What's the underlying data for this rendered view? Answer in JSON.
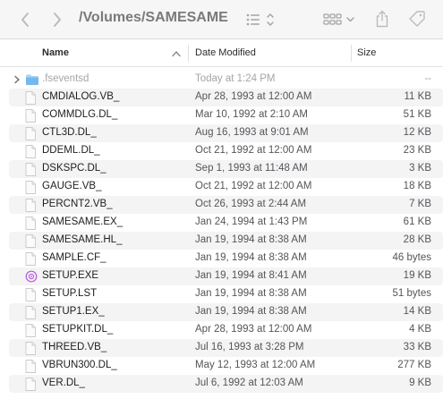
{
  "toolbar": {
    "title": "/Volumes/SAMESAME",
    "icons": [
      "chevron-left-icon",
      "chevron-right-icon",
      "list-view-icon",
      "grid-view-icon",
      "share-icon",
      "tag-icon"
    ]
  },
  "columns": {
    "name": "Name",
    "date": "Date Modified",
    "size": "Size",
    "sort_column": "Name",
    "sort_direction": "ascending"
  },
  "colors": {
    "folder": "#62b0ea",
    "setup_icon": "#b55ad6",
    "row_stripe": "#f4f4f5"
  },
  "files": [
    {
      "name": ".fseventsd",
      "date": "Today at 1:24 PM",
      "size": "--",
      "kind": "folder",
      "hidden": true
    },
    {
      "name": "CMDIALOG.VB_",
      "date": "Apr 28, 1993 at 12:00 AM",
      "size": "11 KB",
      "kind": "document"
    },
    {
      "name": "COMMDLG.DL_",
      "date": "Mar 10, 1992 at 2:10 AM",
      "size": "51 KB",
      "kind": "document"
    },
    {
      "name": "CTL3D.DL_",
      "date": "Aug 16, 1993 at 9:01 AM",
      "size": "12 KB",
      "kind": "document"
    },
    {
      "name": "DDEML.DL_",
      "date": "Oct 21, 1992 at 12:00 AM",
      "size": "23 KB",
      "kind": "document"
    },
    {
      "name": "DSKSPC.DL_",
      "date": "Sep 1, 1993 at 11:48 AM",
      "size": "3 KB",
      "kind": "document"
    },
    {
      "name": "GAUGE.VB_",
      "date": "Oct 21, 1992 at 12:00 AM",
      "size": "18 KB",
      "kind": "document"
    },
    {
      "name": "PERCNT2.VB_",
      "date": "Oct 26, 1993 at 2:44 AM",
      "size": "7 KB",
      "kind": "document"
    },
    {
      "name": "SAMESAME.EX_",
      "date": "Jan 24, 1994 at 1:43 PM",
      "size": "61 KB",
      "kind": "document"
    },
    {
      "name": "SAMESAME.HL_",
      "date": "Jan 19, 1994 at 8:38 AM",
      "size": "28 KB",
      "kind": "document"
    },
    {
      "name": "SAMPLE.CF_",
      "date": "Jan 19, 1994 at 8:38 AM",
      "size": "46 bytes",
      "kind": "document"
    },
    {
      "name": "SETUP.EXE",
      "date": "Jan 19, 1994 at 8:41 AM",
      "size": "19 KB",
      "kind": "executable"
    },
    {
      "name": "SETUP.LST",
      "date": "Jan 19, 1994 at 8:38 AM",
      "size": "51 bytes",
      "kind": "document"
    },
    {
      "name": "SETUP1.EX_",
      "date": "Jan 19, 1994 at 8:38 AM",
      "size": "14 KB",
      "kind": "document"
    },
    {
      "name": "SETUPKIT.DL_",
      "date": "Apr 28, 1993 at 12:00 AM",
      "size": "4 KB",
      "kind": "document"
    },
    {
      "name": "THREED.VB_",
      "date": "Jul 16, 1993 at 3:28 PM",
      "size": "33 KB",
      "kind": "document"
    },
    {
      "name": "VBRUN300.DL_",
      "date": "May 12, 1993 at 12:00 AM",
      "size": "277 KB",
      "kind": "document"
    },
    {
      "name": "VER.DL_",
      "date": "Jul 6, 1992 at 12:03 AM",
      "size": "9 KB",
      "kind": "document"
    }
  ]
}
